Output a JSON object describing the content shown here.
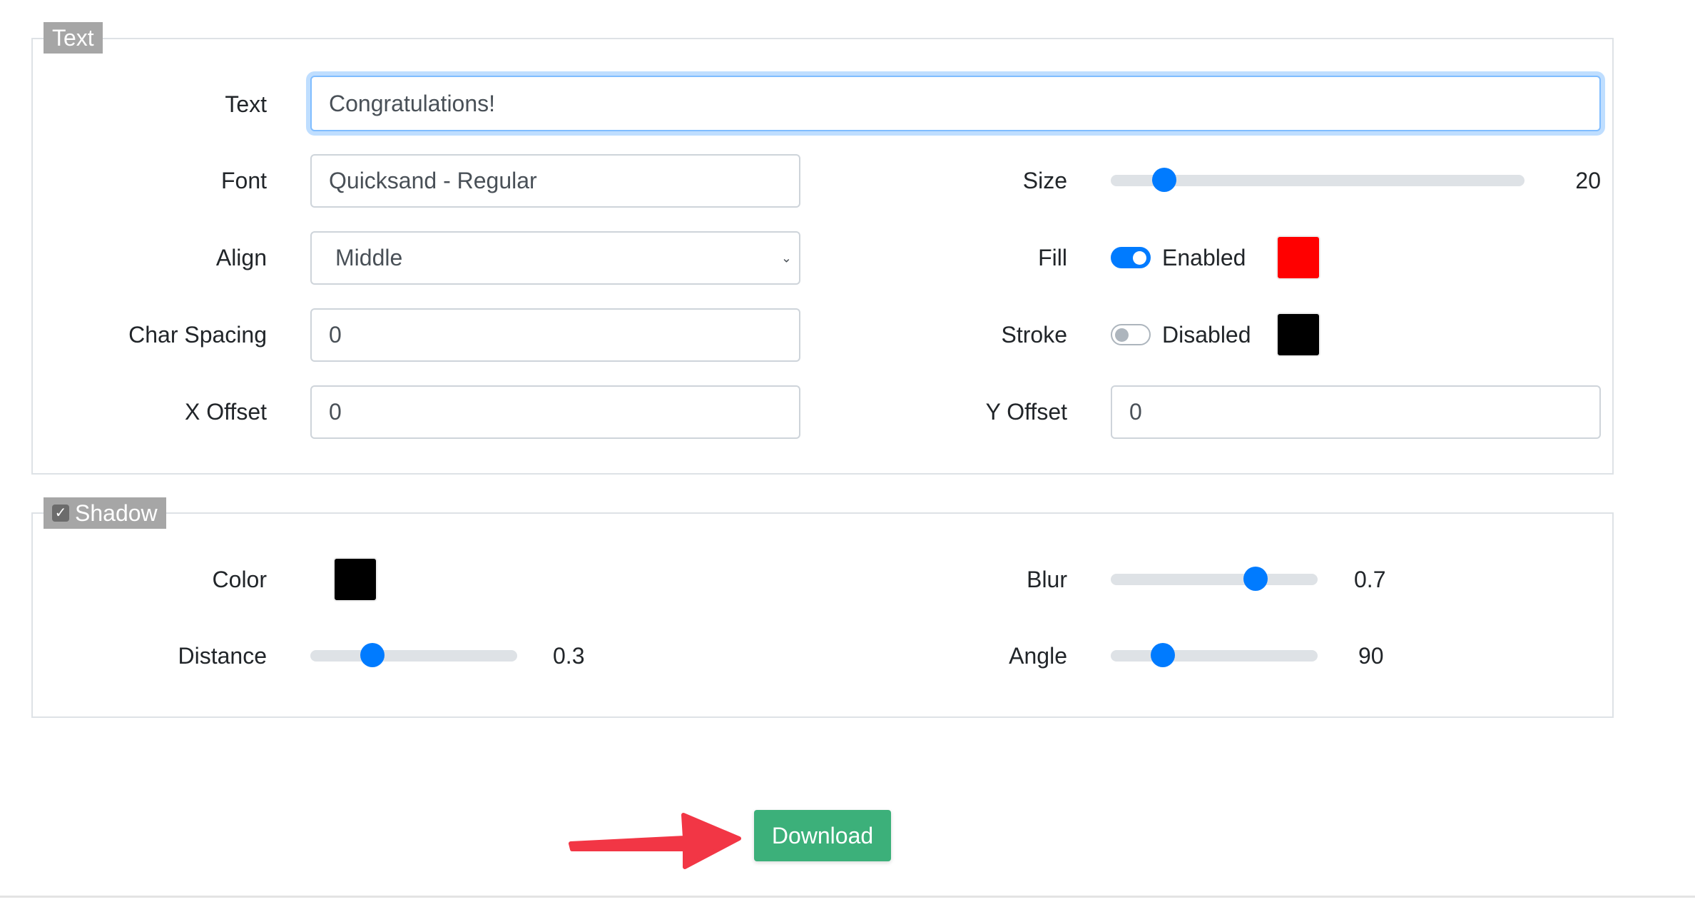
{
  "text_section": {
    "legend": "Text",
    "text": {
      "label": "Text",
      "value": "Congratulations!"
    },
    "font": {
      "label": "Font",
      "value": "Quicksand - Regular"
    },
    "align": {
      "label": "Align",
      "selected": "Middle"
    },
    "char_spacing": {
      "label": "Char Spacing",
      "value": "0"
    },
    "x_offset": {
      "label": "X Offset",
      "value": "0"
    },
    "size": {
      "label": "Size",
      "value": "20",
      "fraction": 0.13
    },
    "fill": {
      "label": "Fill",
      "state": "Enabled",
      "enabled": true,
      "color": "#ff0000"
    },
    "stroke": {
      "label": "Stroke",
      "state": "Disabled",
      "enabled": false,
      "color": "#000000"
    },
    "y_offset": {
      "label": "Y Offset",
      "value": "0"
    }
  },
  "shadow_section": {
    "legend": "Shadow",
    "checked": true,
    "color": {
      "label": "Color",
      "color": "#000000"
    },
    "distance": {
      "label": "Distance",
      "value": "0.3",
      "fraction": 0.3
    },
    "blur": {
      "label": "Blur",
      "value": "0.7",
      "fraction": 0.7
    },
    "angle": {
      "label": "Angle",
      "value": "90",
      "fraction": 0.25
    }
  },
  "actions": {
    "download_label": "Download"
  },
  "colors": {
    "accent": "#007bff",
    "download": "#3cb07a",
    "arrow": "#f23645"
  }
}
